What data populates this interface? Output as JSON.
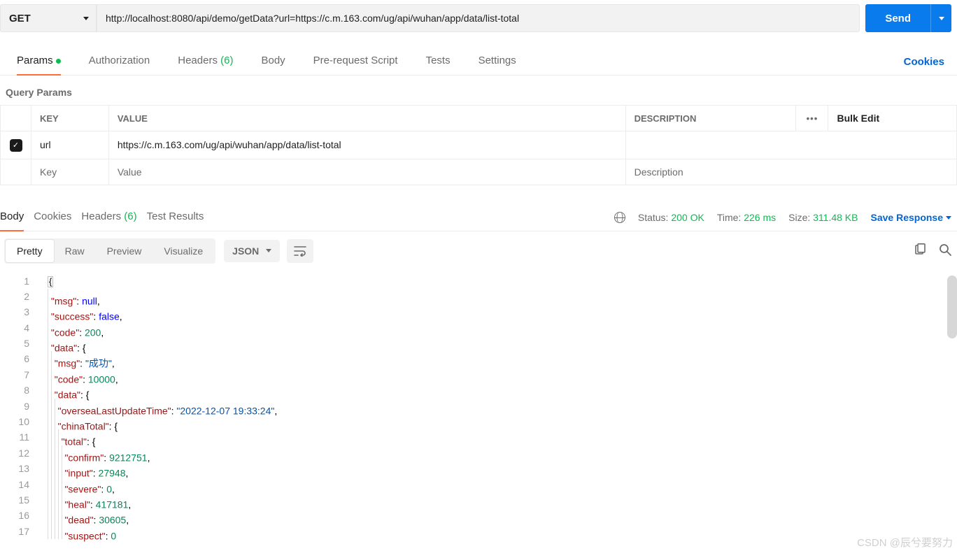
{
  "request": {
    "method": "GET",
    "url": "http://localhost:8080/api/demo/getData?url=https://c.m.163.com/ug/api/wuhan/app/data/list-total",
    "send_label": "Send"
  },
  "req_tabs": {
    "params": "Params",
    "authorization": "Authorization",
    "headers": "Headers",
    "headers_count": "(6)",
    "body": "Body",
    "prerequest": "Pre-request Script",
    "tests": "Tests",
    "settings": "Settings",
    "cookies": "Cookies"
  },
  "query_params": {
    "section_label": "Query Params",
    "header_key": "KEY",
    "header_value": "VALUE",
    "header_desc": "DESCRIPTION",
    "more": "•••",
    "bulk_edit": "Bulk Edit",
    "rows": [
      {
        "enabled": true,
        "key": "url",
        "value": "https://c.m.163.com/ug/api/wuhan/app/data/list-total",
        "description": ""
      }
    ],
    "placeholder_key": "Key",
    "placeholder_value": "Value",
    "placeholder_desc": "Description"
  },
  "resp_tabs": {
    "body": "Body",
    "cookies": "Cookies",
    "headers": "Headers",
    "headers_count": "(6)",
    "test_results": "Test Results",
    "status_label": "Status:",
    "status_value": "200 OK",
    "time_label": "Time:",
    "time_value": "226 ms",
    "size_label": "Size:",
    "size_value": "311.48 KB",
    "save_response": "Save Response"
  },
  "view_bar": {
    "pretty": "Pretty",
    "raw": "Raw",
    "preview": "Preview",
    "visualize": "Visualize",
    "format": "JSON"
  },
  "response_body": {
    "msg": null,
    "success": false,
    "code": 200,
    "data": {
      "msg": "成功",
      "code": 10000,
      "data": {
        "overseaLastUpdateTime": "2022-12-07 19:33:24",
        "chinaTotal": {
          "total": {
            "confirm": 9212751,
            "input": 27948,
            "severe": 0,
            "heal": 417181,
            "dead": 30605,
            "suspect": 0
          }
        }
      }
    }
  },
  "line_numbers": [
    "1",
    "2",
    "3",
    "4",
    "5",
    "6",
    "7",
    "8",
    "9",
    "10",
    "11",
    "12",
    "13",
    "14",
    "15",
    "16",
    "17"
  ],
  "watermark": "CSDN @辰兮要努力"
}
